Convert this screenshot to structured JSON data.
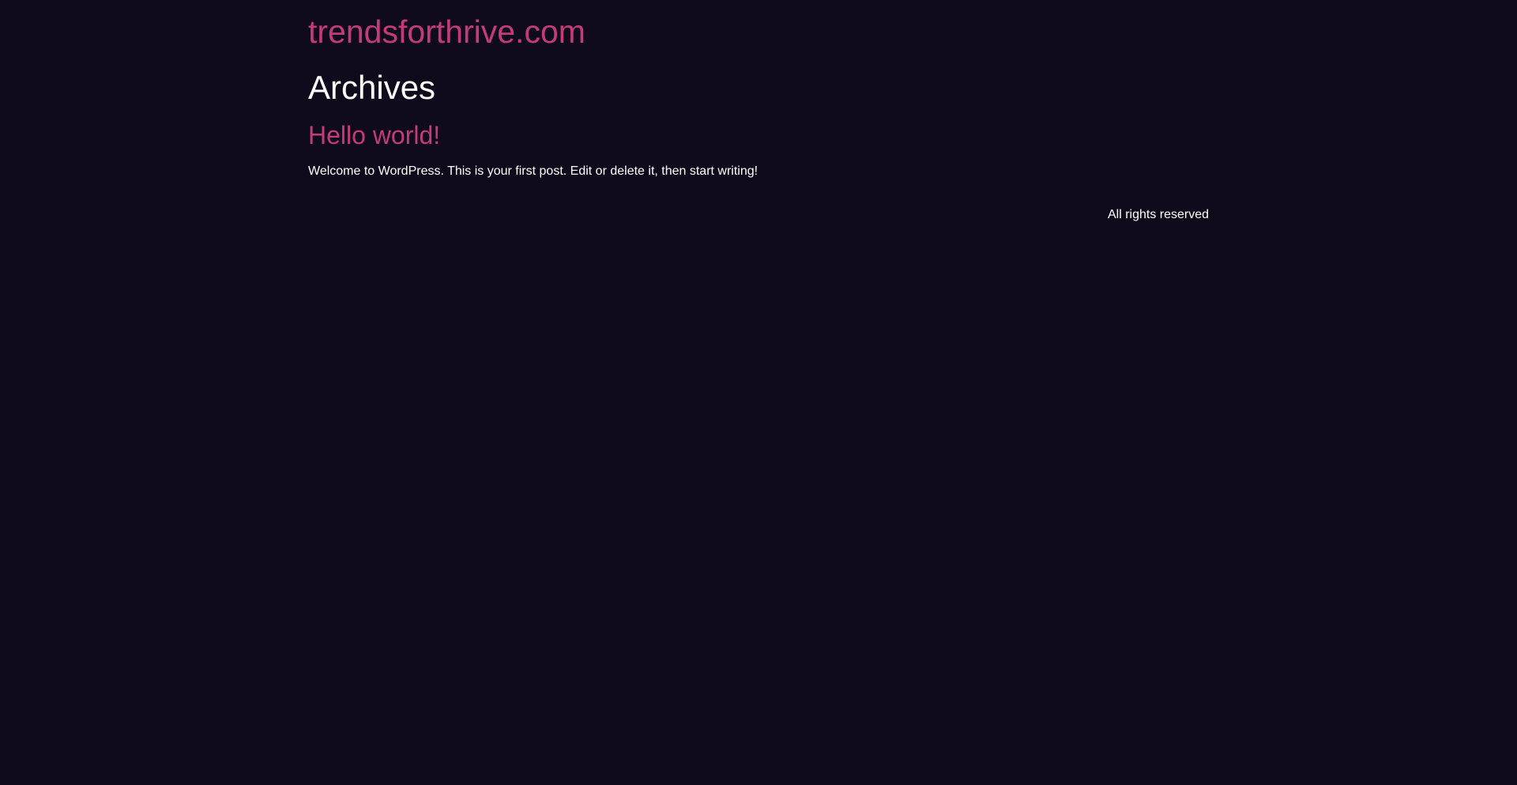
{
  "header": {
    "site_title": "trendsforthrive.com"
  },
  "main": {
    "archive_title": "Archives",
    "posts": [
      {
        "title": "Hello world!",
        "excerpt": "Welcome to WordPress. This is your first post. Edit or delete it, then start writing!"
      }
    ]
  },
  "footer": {
    "text": "All rights reserved"
  },
  "colors": {
    "background": "#100a1d",
    "accent": "#c43b7a",
    "text": "#ffffff"
  }
}
